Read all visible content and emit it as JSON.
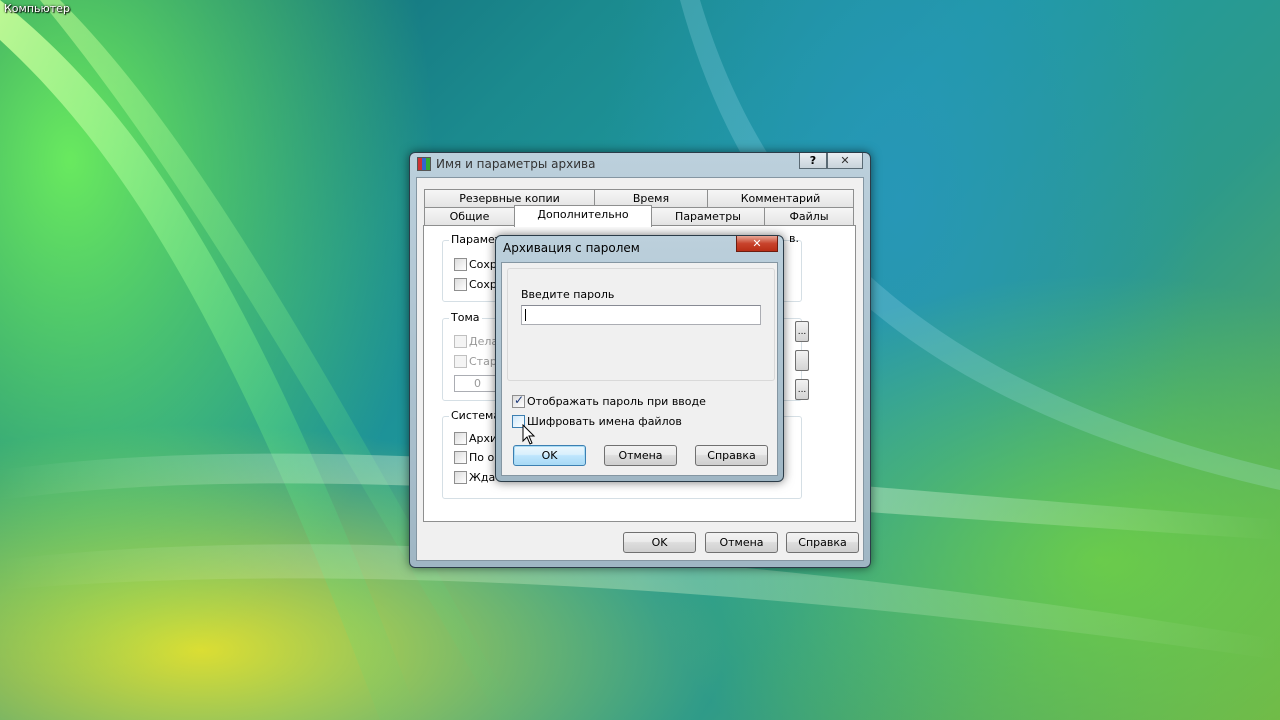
{
  "desktop": {
    "computer_icon_label": "Компьютер"
  },
  "archive_window": {
    "title": "Имя и параметры архива",
    "help_button": "?",
    "close_button": "✕",
    "tabs_row1": [
      "Резервные копии",
      "Время",
      "Комментарий"
    ],
    "tabs_row2": [
      "Общие",
      "Дополнительно",
      "Параметры",
      "Файлы"
    ],
    "active_tab": "Дополнительно",
    "group_params": {
      "title": "Парамет",
      "items": [
        {
          "label": "Сохра",
          "checked": false
        },
        {
          "label": "Сохра",
          "checked": false
        }
      ],
      "title_tail": "в."
    },
    "group_volumes": {
      "title": "Тома",
      "items": [
        {
          "label": "Дела",
          "checked": false,
          "disabled": true
        },
        {
          "label": "Стар",
          "checked": false,
          "disabled": true
        }
      ],
      "spin_value": "0",
      "ellipsis": "..."
    },
    "group_system": {
      "title": "Система",
      "items": [
        {
          "label": "Архив",
          "checked": false
        },
        {
          "label": "По ок",
          "checked": false
        },
        {
          "label": "Ждат",
          "checked": false
        }
      ]
    },
    "buttons": {
      "ok": "OK",
      "cancel": "Отмена",
      "help": "Справка"
    }
  },
  "password_dialog": {
    "title": "Архивация с паролем",
    "close_button": "✕",
    "password_label": "Введите пароль",
    "password_value": "",
    "show_password": {
      "label": "Отображать пароль при вводе",
      "checked": true
    },
    "encrypt_names": {
      "label": "Шифровать имена файлов",
      "checked": false
    },
    "buttons": {
      "ok": "OK",
      "cancel": "Отмена",
      "help": "Справка"
    }
  }
}
